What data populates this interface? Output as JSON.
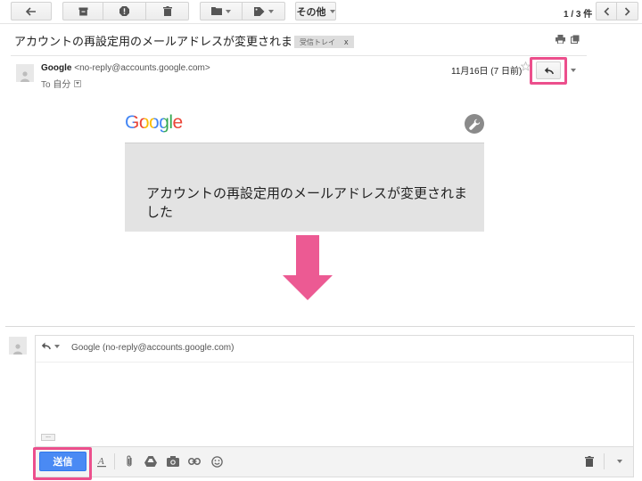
{
  "toolbar": {
    "more_label": "その他",
    "pagination": "1 / 3 件",
    "icons": [
      "reply-arrow-icon",
      "archive-icon",
      "spam-icon",
      "trash-icon",
      "folder-icon",
      "tag-icon",
      "chevron-left-icon",
      "chevron-right-icon"
    ]
  },
  "thread": {
    "subject": "アカウントの再設定用のメールアドレスが変更されました",
    "label": "受信トレイ",
    "label_close": "x"
  },
  "message": {
    "sender_name": "Google",
    "sender_email": "<no-reply@accounts.google.com>",
    "to": "To 自分",
    "date": "11月16日 (7 日前)"
  },
  "email_body": {
    "logo_text": "Google",
    "headline": "アカウントの再設定用のメールアドレスが変更されました"
  },
  "compose": {
    "recipient": "Google (no-reply@accounts.google.com)",
    "expand": "...",
    "send_label": "送信"
  },
  "colors": {
    "highlight": "#ec4f8c",
    "arrow": "#ec5a93",
    "send": "#4a8af4",
    "google_blue": "#4285F4",
    "google_red": "#EA4335",
    "google_yellow": "#FBBC05",
    "google_green": "#34A853"
  }
}
